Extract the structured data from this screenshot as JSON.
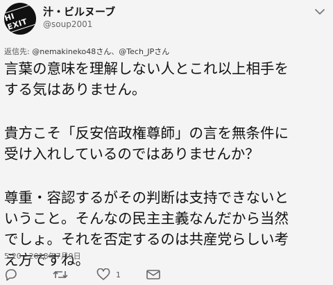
{
  "author": {
    "display_name": "汁・ビルヌーブ",
    "handle": "@soup2001",
    "avatar_text": "HI EXIT"
  },
  "reply": {
    "prefix": "返信先:",
    "mention1": "@nemakineko48さん",
    "separator": "、",
    "mention2": "@Tech_JPさん"
  },
  "tweet": {
    "lines": [
      "言葉の意味を理解しない人とこれ以上相手を",
      "する気はありません。",
      "貴方こそ「反安倍政権尊師」の言を無条件に",
      "受け入れしているのではありませんか？",
      "尊重・容認するがその判断は支持できないと",
      "いうこと。そんなの民主主義なんだから当然",
      "でしょ。それを否定するのは共産党らしい考",
      "え方ですね。"
    ],
    "timestamp": "5:20 - 2018年7月9日"
  },
  "actions": {
    "reply_icon": "reply-icon",
    "retweet_icon": "retweet-icon",
    "like_icon": "heart-icon",
    "like_count": "1",
    "dm_icon": "envelope-icon"
  }
}
